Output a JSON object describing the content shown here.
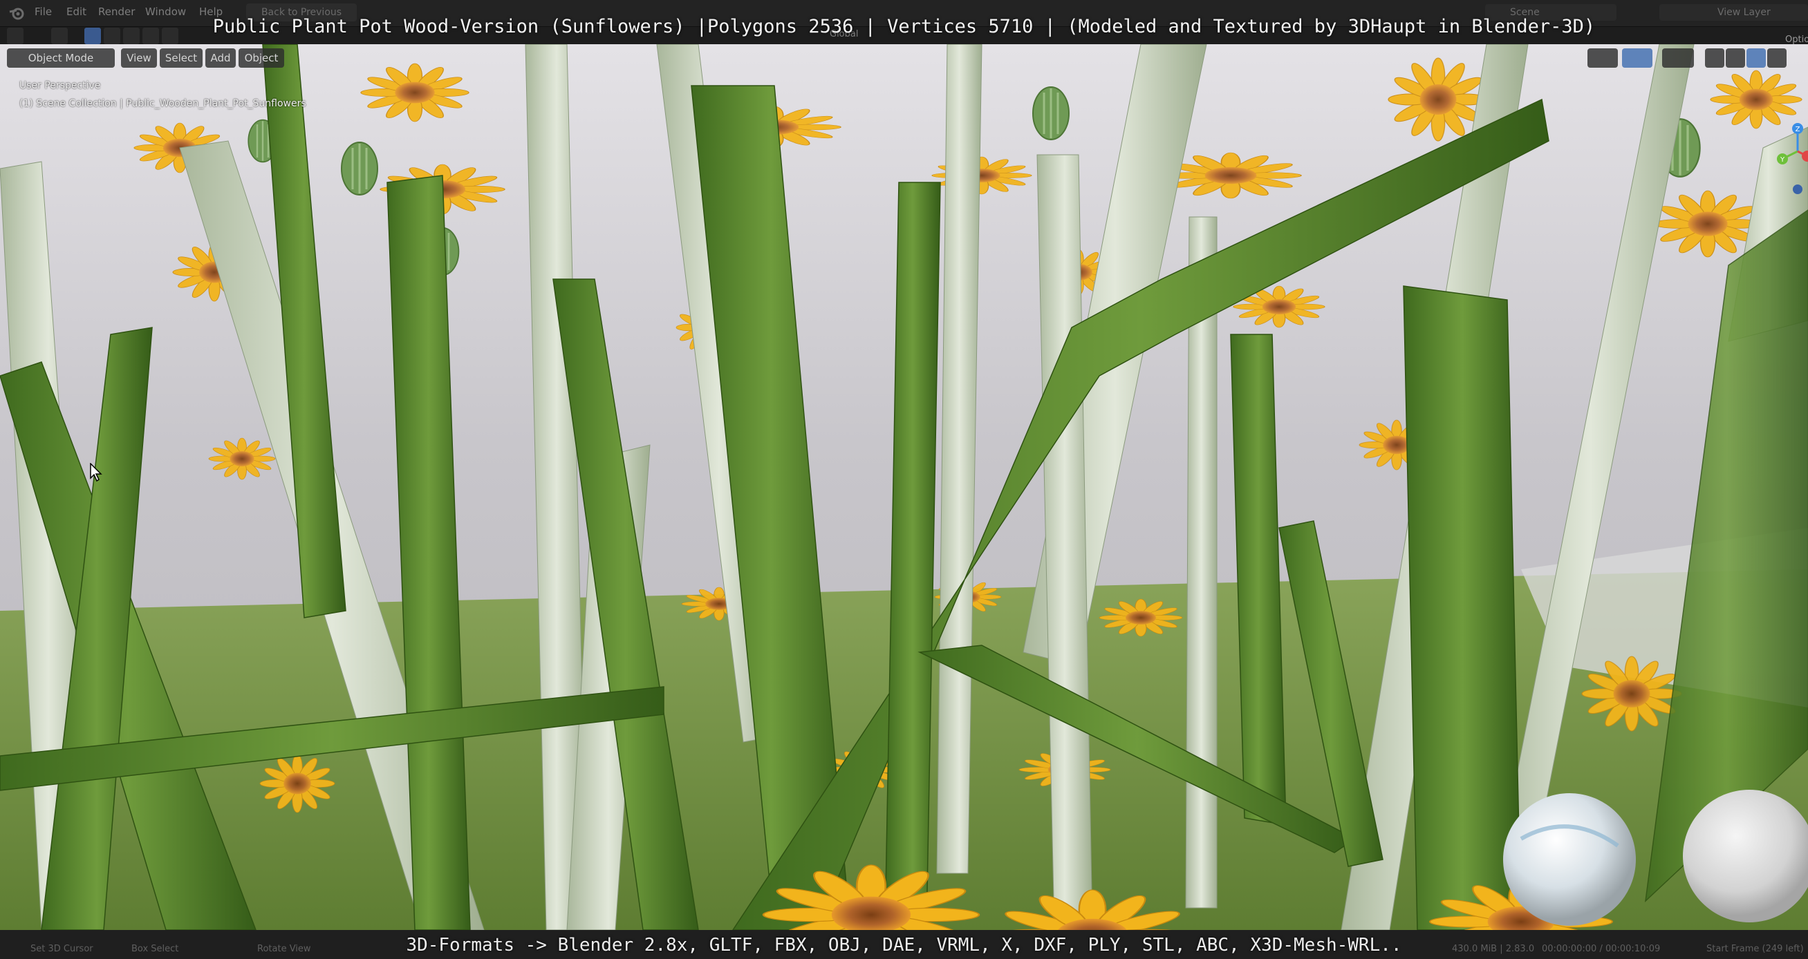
{
  "overlay": {
    "title": "Public Plant Pot Wood-Version (Sunflowers) |Polygons 2536 | Vertices 5710 | (Modeled and Textured by 3DHaupt in Blender-3D)",
    "formats": "3D-Formats -> Blender 2.8x, GLTF, FBX, OBJ, DAE, VRML, X, DXF, PLY, STL, ABC, X3D-Mesh-WRL.."
  },
  "topbar": {
    "menu": [
      "File",
      "Edit",
      "Render",
      "Window",
      "Help"
    ],
    "back_button": "Back to Previous",
    "orientation": "Global",
    "scene": "Scene",
    "view_layer": "View Layer",
    "options": "Options"
  },
  "viewport": {
    "mode": "Object Mode",
    "menus": [
      "View",
      "Select",
      "Add",
      "Object"
    ],
    "perspective": "User Perspective",
    "collection": "(1) Scene Collection | Public_Wooden_Plant_Pot_Sunflowers",
    "gizmo_axes": [
      "X",
      "Y",
      "Z"
    ]
  },
  "statusbar": {
    "left": [
      "Set 3D Cursor",
      "Box Select",
      "Rotate View"
    ],
    "right": "430.0 MiB | 2.83.0",
    "time": "00:00:00:00 / 00:00:10:09",
    "frame": "Start Frame (249 left)"
  },
  "colors": {
    "accent": "#4772b3",
    "sunflower_petal": "#f2b41c",
    "sunflower_center": "#b0632a",
    "stem_green": "#4e7d2a",
    "pale_stem": "#cdd7c0",
    "sky": "#d3d1d6"
  },
  "icons": [
    "blender-logo-icon",
    "mouse-cursor-icon",
    "transform-gizmo-icon"
  ]
}
